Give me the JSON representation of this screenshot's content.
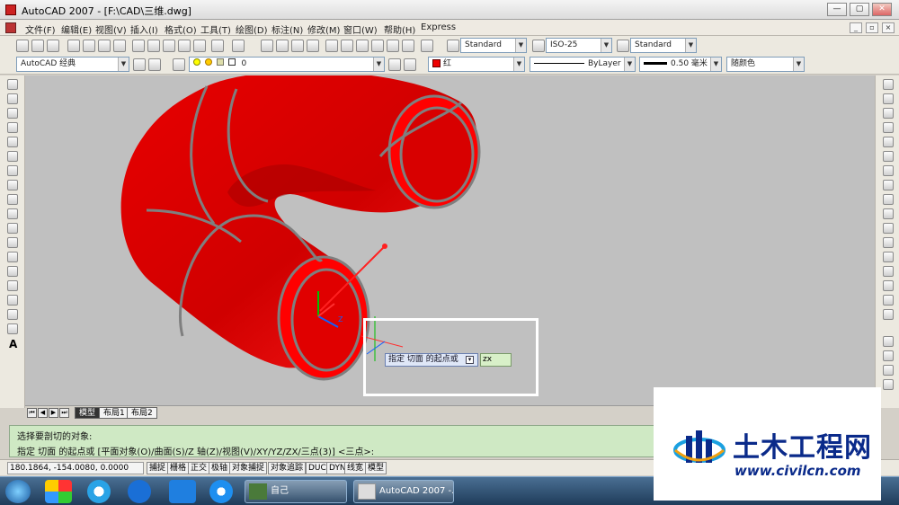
{
  "window": {
    "title": "AutoCAD 2007 - [F:\\CAD\\三维.dwg]",
    "controls": [
      "—",
      "▢",
      "✕"
    ],
    "mdi_controls": [
      "_",
      "▫",
      "×"
    ]
  },
  "menu": [
    "文件(F)",
    "编辑(E)",
    "视图(V)",
    "插入(I)",
    "格式(O)",
    "工具(T)",
    "绘图(D)",
    "标注(N)",
    "修改(M)",
    "窗口(W)",
    "帮助(H)",
    "Express"
  ],
  "toolbar1": {
    "text_style": "Standard",
    "dim_style": "ISO-25",
    "table_style": "Standard"
  },
  "toolbar2": {
    "workspace": "AutoCAD 经典",
    "layer": "0",
    "color": "红",
    "linetype": "ByLayer",
    "lineweight": "0.50 毫米",
    "plotstyle": "随颜色"
  },
  "left_tools_text": "A",
  "layout_tabs": [
    "模型",
    "布局1",
    "布局2"
  ],
  "layout_nav": [
    "⏮",
    "◀",
    "▶",
    "⏭"
  ],
  "command": {
    "line1": "选择要剖切的对象:",
    "line2": "指定 切面 的起点或 [平面对象(O)/曲面(S)/Z 轴(Z)/视图(V)/XY/YZ/ZX/三点(3)] <三点>:"
  },
  "dynamic_input": {
    "prompt": "指定 切面 的起点或",
    "dropdown_glyph": "▾",
    "value": "zx"
  },
  "ucs": {
    "z_label": "Z"
  },
  "status": {
    "coords": "180.1864,  -154.0080, 0.0000",
    "buttons": [
      "捕捉",
      "栅格",
      "正交",
      "极轴",
      "对象捕捉",
      "对象追踪",
      "DUCS",
      "DYN",
      "线宽",
      "模型"
    ]
  },
  "taskbar": {
    "item1": "自己",
    "item2": "AutoCAD 2007 -..."
  },
  "watermark": {
    "name": "土木工程网",
    "url": "www.civilcn.com"
  },
  "colors": {
    "object": "#e00000",
    "edges": "#808080",
    "background": "#c0c0c0",
    "command_bg": "#cfe9c4"
  }
}
